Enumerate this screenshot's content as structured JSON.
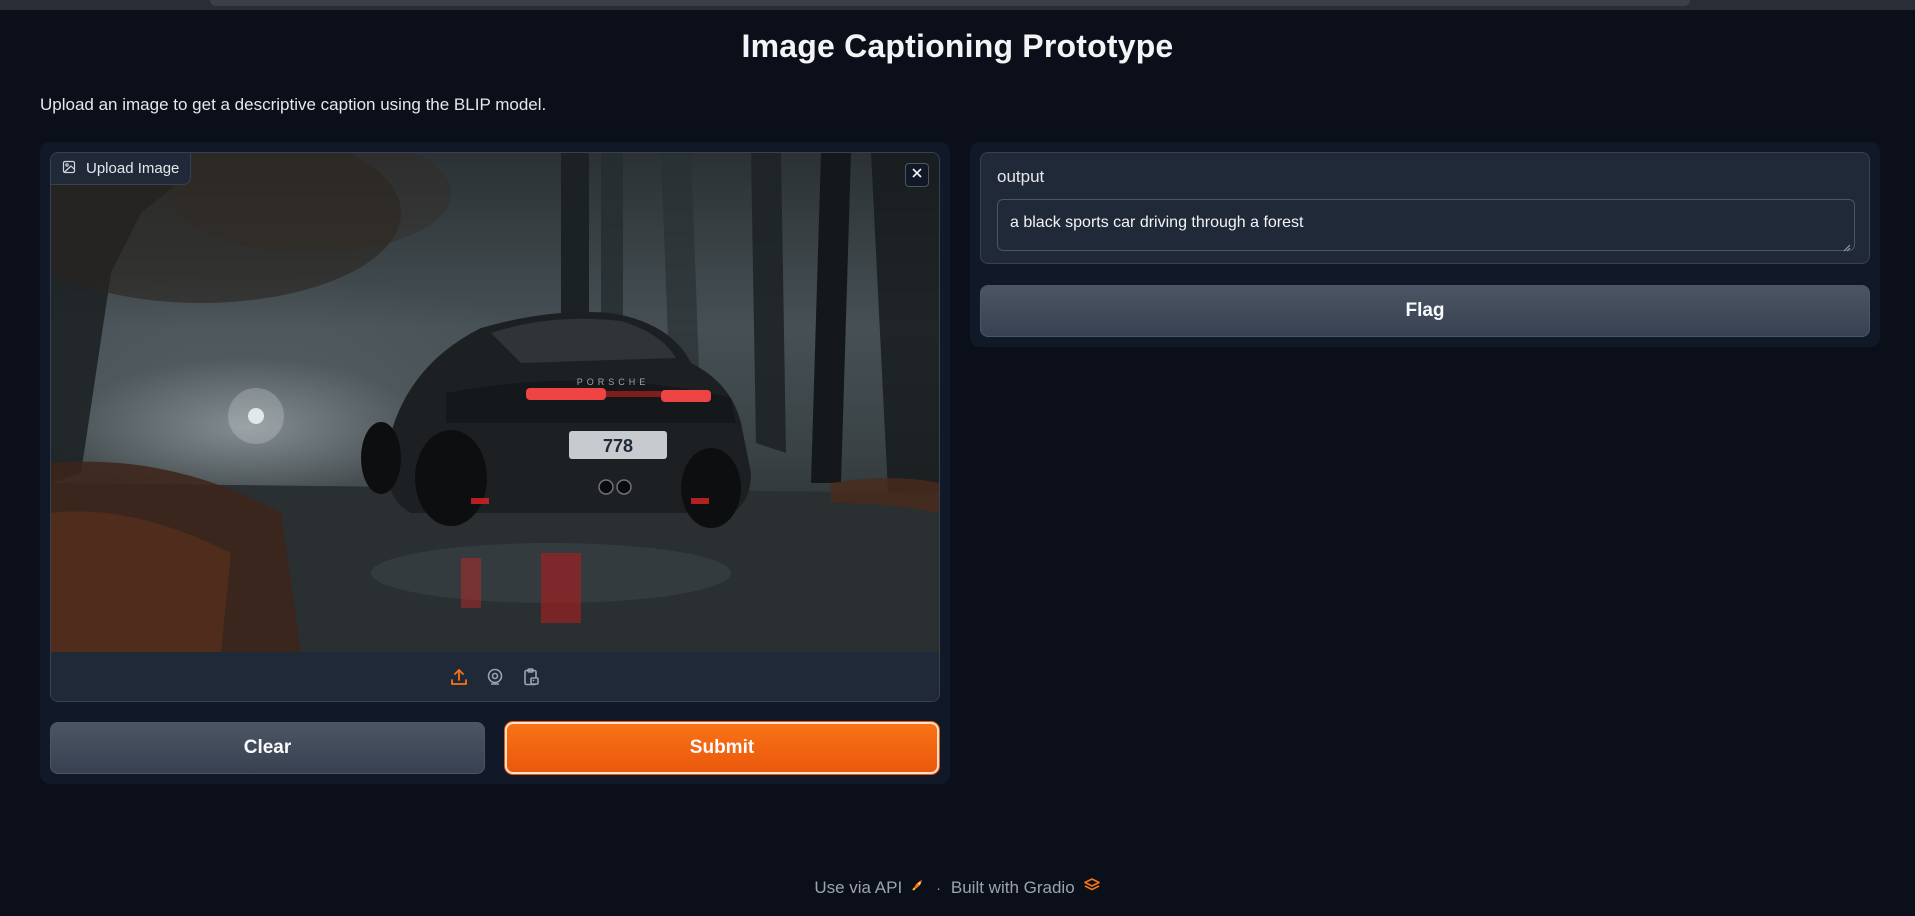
{
  "page": {
    "title": "Image Captioning Prototype",
    "description": "Upload an image to get a descriptive caption using the BLIP model."
  },
  "input_image": {
    "label": "Upload Image",
    "label_icon": "image-icon",
    "close_icon": "close-icon",
    "license_plate": "778",
    "brand_text": "PORSCHE",
    "sources": [
      {
        "name": "upload-icon",
        "color": "#f97316"
      },
      {
        "name": "webcam-icon",
        "color": "#9ca3af"
      },
      {
        "name": "clipboard-icon",
        "color": "#9ca3af"
      }
    ]
  },
  "buttons": {
    "clear_label": "Clear",
    "submit_label": "Submit",
    "flag_label": "Flag"
  },
  "output": {
    "label": "output",
    "value": "a black sports car driving through a forest"
  },
  "footer": {
    "api_label": "Use via API",
    "separator": "·",
    "built_label": "Built with Gradio"
  },
  "colors": {
    "background": "#0b0f19",
    "panel": "#111827",
    "block": "#1f2937",
    "accent": "#f97316"
  }
}
